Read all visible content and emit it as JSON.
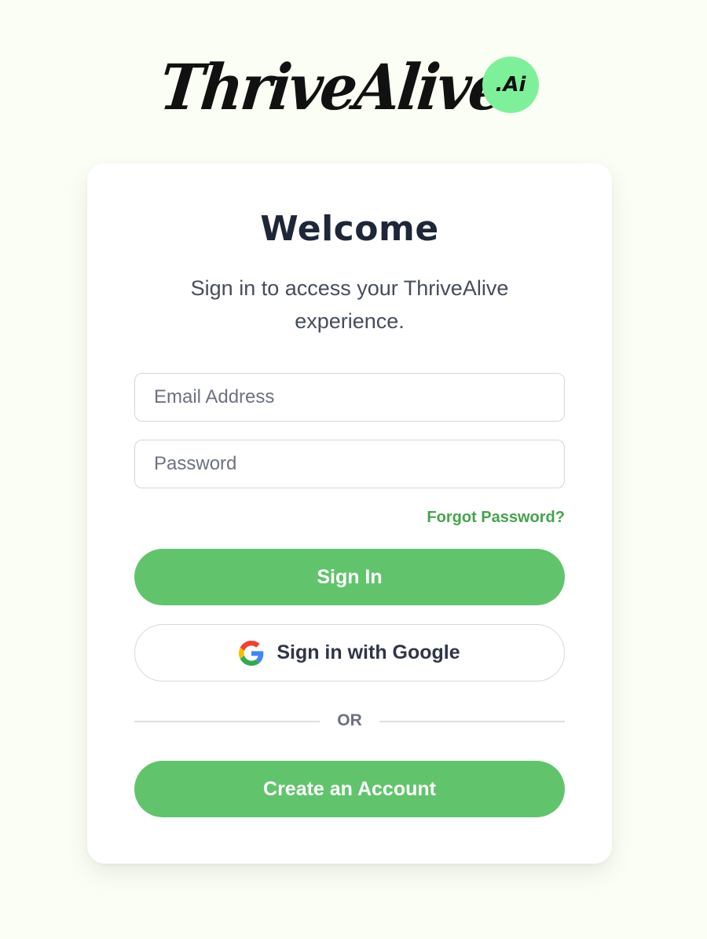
{
  "logo": {
    "wordmark": "ThriveAlive",
    "badge": ".Ai",
    "badge_color": "#7ff09a"
  },
  "card": {
    "title": "Welcome",
    "subtitle": "Sign in to access your ThriveAlive experience."
  },
  "form": {
    "email_placeholder": "Email Address",
    "password_placeholder": "Password",
    "forgot_label": "Forgot Password?",
    "signin_label": "Sign In",
    "google_label": "Sign in with Google",
    "divider_label": "OR",
    "create_label": "Create an Account"
  },
  "colors": {
    "background": "#fbfef4",
    "accent": "#61c46c",
    "link": "#47a24e",
    "heading": "#1e2738"
  },
  "icons": {
    "google": "google-g-icon"
  }
}
